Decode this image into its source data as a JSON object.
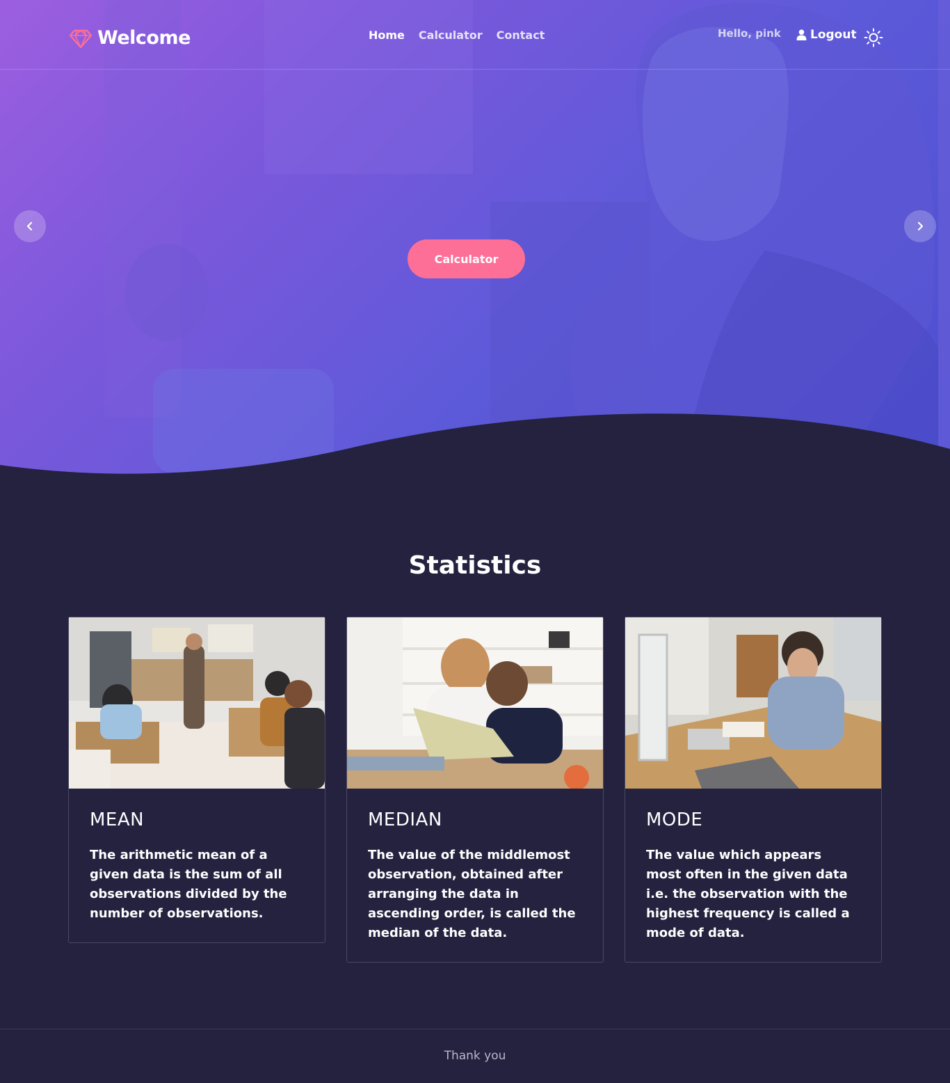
{
  "nav": {
    "brand": "Welcome",
    "menu": [
      {
        "label": "Home"
      },
      {
        "label": "Calculator"
      },
      {
        "label": "Contact"
      }
    ],
    "greeting": "Hello, pink",
    "logout_label": "Logout",
    "icons": {
      "brand": "gem-icon",
      "user": "user-icon",
      "theme": "sun-icon"
    }
  },
  "hero": {
    "cta_label": "Calculator",
    "prev_icon": "chevron-left-icon",
    "next_icon": "chevron-right-icon"
  },
  "statistics": {
    "title": "Statistics",
    "cards": [
      {
        "title": "MEAN",
        "text": "The arithmetic mean of a given data is the sum of all observations divided by the number of observations."
      },
      {
        "title": "MEDIAN",
        "text": "The value of the middlemost observation, obtained after arranging the data in ascending order, is called the median of the data."
      },
      {
        "title": "MODE",
        "text": "The value which appears most often in the given data i.e. the observation with the highest frequency is called a mode of data."
      }
    ]
  },
  "footer": {
    "text": "Thank you"
  },
  "colors": {
    "accent": "#fd6f96",
    "background": "#24223f",
    "hero_start": "#9d5ee0",
    "hero_end": "#4a4fd0"
  }
}
